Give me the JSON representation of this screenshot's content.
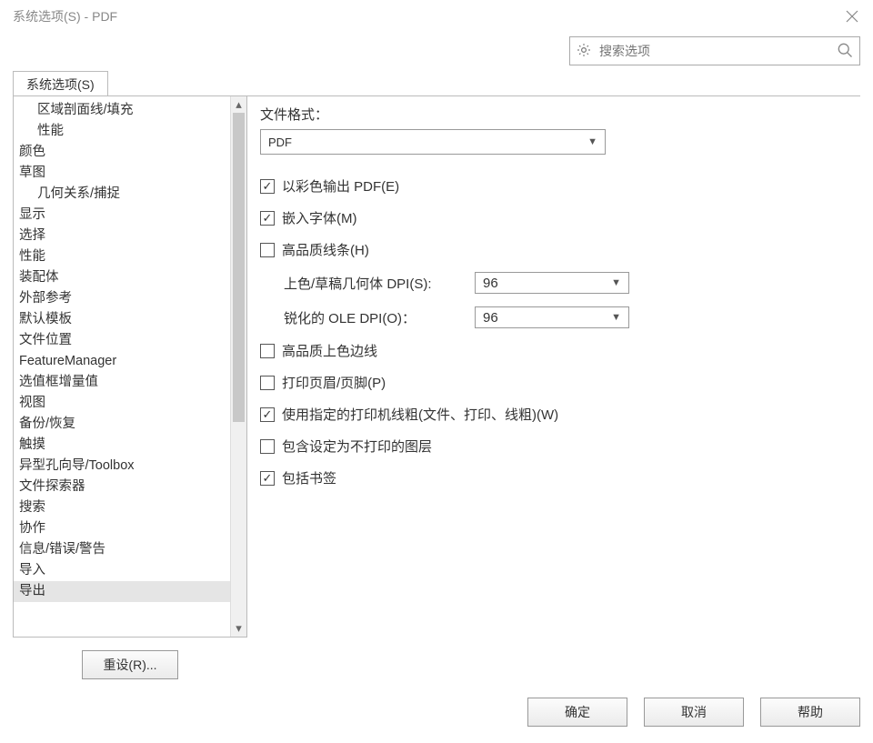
{
  "title": "系统选项(S) - PDF",
  "search": {
    "placeholder": "搜索选项"
  },
  "tab_label": "系统选项(S)",
  "tree": {
    "items": [
      {
        "label": "区域剖面线/填充",
        "indent": 1
      },
      {
        "label": "性能",
        "indent": 1
      },
      {
        "label": "颜色",
        "indent": 0
      },
      {
        "label": "草图",
        "indent": 0
      },
      {
        "label": "几何关系/捕捉",
        "indent": 1
      },
      {
        "label": "显示",
        "indent": 0
      },
      {
        "label": "选择",
        "indent": 0
      },
      {
        "label": "性能",
        "indent": 0
      },
      {
        "label": "装配体",
        "indent": 0
      },
      {
        "label": "外部参考",
        "indent": 0
      },
      {
        "label": "默认模板",
        "indent": 0
      },
      {
        "label": "文件位置",
        "indent": 0
      },
      {
        "label": "FeatureManager",
        "indent": 0
      },
      {
        "label": "选值框增量值",
        "indent": 0
      },
      {
        "label": "视图",
        "indent": 0
      },
      {
        "label": "备份/恢复",
        "indent": 0
      },
      {
        "label": "触摸",
        "indent": 0
      },
      {
        "label": "异型孔向导/Toolbox",
        "indent": 0
      },
      {
        "label": "文件探索器",
        "indent": 0
      },
      {
        "label": "搜索",
        "indent": 0
      },
      {
        "label": "协作",
        "indent": 0
      },
      {
        "label": "信息/错误/警告",
        "indent": 0
      },
      {
        "label": "导入",
        "indent": 0
      },
      {
        "label": "导出",
        "indent": 0,
        "selected": true
      }
    ]
  },
  "format_label": "文件格式：",
  "format_value": "PDF",
  "checks": {
    "color_output": {
      "label": "以彩色输出 PDF(E)",
      "checked": true
    },
    "embed_fonts": {
      "label": "嵌入字体(M)",
      "checked": true
    },
    "hq_lines": {
      "label": "高品质线条(H)",
      "checked": false
    },
    "hq_shaded": {
      "label": "高品质上色边线",
      "checked": false
    },
    "print_header": {
      "label": "打印页眉/页脚(P)",
      "checked": false
    },
    "printer_linewidth": {
      "label": "使用指定的打印机线粗(文件、打印、线粗)(W)",
      "checked": true
    },
    "include_noprint": {
      "label": "包含设定为不打印的图层",
      "checked": false
    },
    "bookmarks": {
      "label": "包括书签",
      "checked": true
    }
  },
  "dpi": {
    "draft_label": "上色/草稿几何体 DPI(S):",
    "draft_value": "96",
    "ole_label": "锐化的 OLE DPI(O)：",
    "ole_value": "96"
  },
  "buttons": {
    "reset": "重设(R)...",
    "ok": "确定",
    "cancel": "取消",
    "help": "帮助"
  }
}
